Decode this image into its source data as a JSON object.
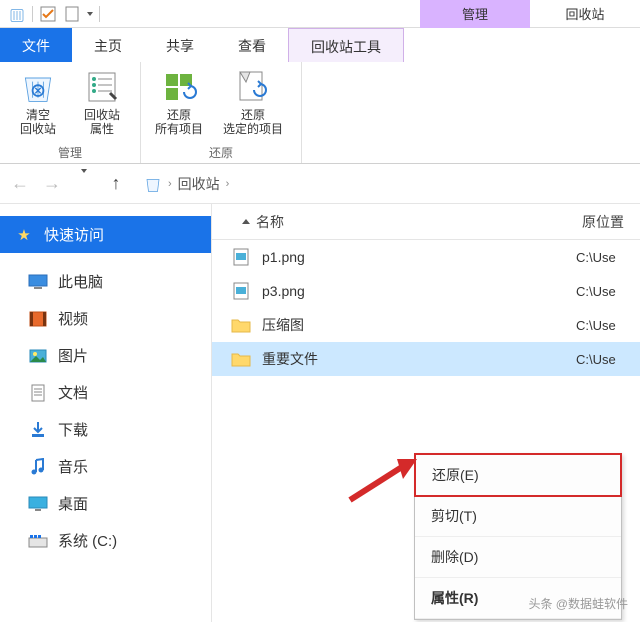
{
  "title_tabs": {
    "manage": "管理",
    "recycle": "回收站"
  },
  "ribbon_tabs": {
    "file": "文件",
    "home": "主页",
    "share": "共享",
    "view": "查看",
    "tools": "回收站工具"
  },
  "ribbon": {
    "empty": {
      "l1": "清空",
      "l2": "回收站"
    },
    "props": {
      "l1": "回收站",
      "l2": "属性"
    },
    "restore_all": {
      "l1": "还原",
      "l2": "所有项目"
    },
    "restore_sel": {
      "l1": "还原",
      "l2": "选定的项目"
    },
    "group_manage": "管理",
    "group_restore": "还原"
  },
  "nav": {
    "location": "回收站"
  },
  "navpane": {
    "quick": "快速访问",
    "pc": "此电脑",
    "videos": "视频",
    "pictures": "图片",
    "docs": "文档",
    "downloads": "下载",
    "music": "音乐",
    "desktop": "桌面",
    "system": "系统 (C:)"
  },
  "columns": {
    "name": "名称",
    "orig": "原位置"
  },
  "rows": [
    {
      "name": "p1.png",
      "type": "img",
      "loc": "C:\\Use"
    },
    {
      "name": "p3.png",
      "type": "img",
      "loc": "C:\\Use"
    },
    {
      "name": "压缩图",
      "type": "folder",
      "loc": "C:\\Use"
    },
    {
      "name": "重要文件",
      "type": "folder",
      "loc": "C:\\Use",
      "selected": true
    }
  ],
  "context_menu": [
    {
      "label": "还原(E)",
      "hl": true
    },
    {
      "label": "剪切(T)"
    },
    {
      "label": "删除(D)"
    },
    {
      "label": "属性(R)",
      "bold": true
    }
  ],
  "watermark": "头条 @数据蛙软件"
}
